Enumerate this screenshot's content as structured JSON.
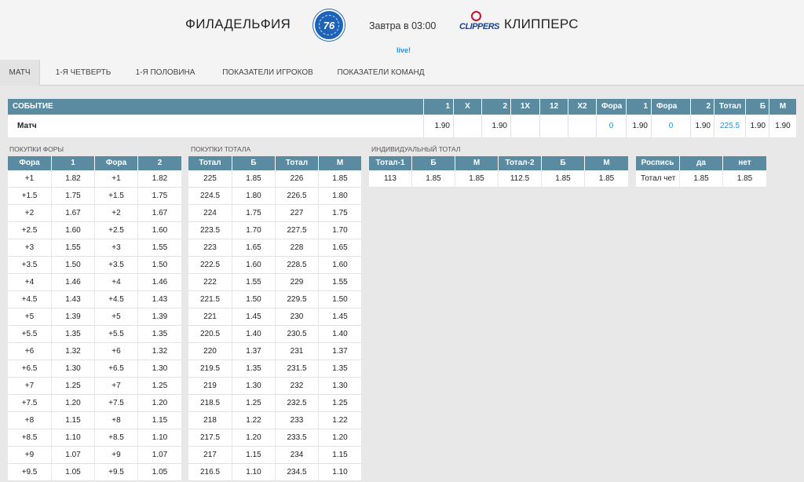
{
  "header": {
    "team1": "ФИЛАДЕЛЬФИЯ",
    "team1_logo_text": "76",
    "time": "Завтра в 03:00",
    "team2_logo_text": "CLIPPERS",
    "team2": "КЛИППЕРС",
    "live": "live!"
  },
  "tabs": [
    {
      "label": "МАТЧ",
      "active": true
    },
    {
      "label": "1-Я ЧЕТВЕРТЬ"
    },
    {
      "label": "1-Я ПОЛОВИНА"
    },
    {
      "label": "ПОКАЗАТЕЛИ ИГРОКОВ"
    },
    {
      "label": "ПОКАЗАТЕЛИ КОМАНД"
    }
  ],
  "event_table": {
    "headers": [
      "СОБЫТИЕ",
      "1",
      "X",
      "2",
      "1X",
      "12",
      "X2",
      "Фора",
      "1",
      "Фора",
      "2",
      "Тотал",
      "Б",
      "М"
    ],
    "row": [
      "Матч",
      "1.90",
      "",
      "1.90",
      "",
      "",
      "",
      "0",
      "1.90",
      "0",
      "1.90",
      "225.5",
      "1.90",
      "1.90"
    ]
  },
  "handicap": {
    "title": "ПОКУПКИ ФОРЫ",
    "headers": [
      "Фора",
      "1",
      "Фора",
      "2"
    ],
    "rows": [
      [
        "+1",
        "1.82",
        "+1",
        "1.82"
      ],
      [
        "+1.5",
        "1.75",
        "+1.5",
        "1.75"
      ],
      [
        "+2",
        "1.67",
        "+2",
        "1.67"
      ],
      [
        "+2.5",
        "1.60",
        "+2.5",
        "1.60"
      ],
      [
        "+3",
        "1.55",
        "+3",
        "1.55"
      ],
      [
        "+3.5",
        "1.50",
        "+3.5",
        "1.50"
      ],
      [
        "+4",
        "1.46",
        "+4",
        "1.46"
      ],
      [
        "+4.5",
        "1.43",
        "+4.5",
        "1.43"
      ],
      [
        "+5",
        "1.39",
        "+5",
        "1.39"
      ],
      [
        "+5.5",
        "1.35",
        "+5.5",
        "1.35"
      ],
      [
        "+6",
        "1.32",
        "+6",
        "1.32"
      ],
      [
        "+6.5",
        "1.30",
        "+6.5",
        "1.30"
      ],
      [
        "+7",
        "1.25",
        "+7",
        "1.25"
      ],
      [
        "+7.5",
        "1.20",
        "+7.5",
        "1.20"
      ],
      [
        "+8",
        "1.15",
        "+8",
        "1.15"
      ],
      [
        "+8.5",
        "1.10",
        "+8.5",
        "1.10"
      ],
      [
        "+9",
        "1.07",
        "+9",
        "1.07"
      ],
      [
        "+9.5",
        "1.05",
        "+9.5",
        "1.05"
      ]
    ]
  },
  "totals": {
    "title": "ПОКУПКИ ТОТАЛА",
    "headers": [
      "Тотал",
      "Б",
      "Тотал",
      "М"
    ],
    "rows": [
      [
        "225",
        "1.85",
        "226",
        "1.85"
      ],
      [
        "224.5",
        "1.80",
        "226.5",
        "1.80"
      ],
      [
        "224",
        "1.75",
        "227",
        "1.75"
      ],
      [
        "223.5",
        "1.70",
        "227.5",
        "1.70"
      ],
      [
        "223",
        "1.65",
        "228",
        "1.65"
      ],
      [
        "222.5",
        "1.60",
        "228.5",
        "1.60"
      ],
      [
        "222",
        "1.55",
        "229",
        "1.55"
      ],
      [
        "221.5",
        "1.50",
        "229.5",
        "1.50"
      ],
      [
        "221",
        "1.45",
        "230",
        "1.45"
      ],
      [
        "220.5",
        "1.40",
        "230.5",
        "1.40"
      ],
      [
        "220",
        "1.37",
        "231",
        "1.37"
      ],
      [
        "219.5",
        "1.35",
        "231.5",
        "1.35"
      ],
      [
        "219",
        "1.30",
        "232",
        "1.30"
      ],
      [
        "218.5",
        "1.25",
        "232.5",
        "1.25"
      ],
      [
        "218",
        "1.22",
        "233",
        "1.22"
      ],
      [
        "217.5",
        "1.20",
        "233.5",
        "1.20"
      ],
      [
        "217",
        "1.15",
        "234",
        "1.15"
      ],
      [
        "216.5",
        "1.10",
        "234.5",
        "1.10"
      ]
    ]
  },
  "individual": {
    "title": "ИНДИВИДУАЛЬНЫЙ ТОТАЛ",
    "headers": [
      "Тотал-1",
      "Б",
      "М",
      "Тотал-2",
      "Б",
      "М"
    ],
    "rows": [
      [
        "113",
        "1.85",
        "1.85",
        "112.5",
        "1.85",
        "1.85"
      ]
    ]
  },
  "rospis": {
    "headers": [
      "Роспись",
      "да",
      "нет"
    ],
    "rows": [
      [
        "Тотал чет",
        "1.85",
        "1.85"
      ]
    ]
  }
}
